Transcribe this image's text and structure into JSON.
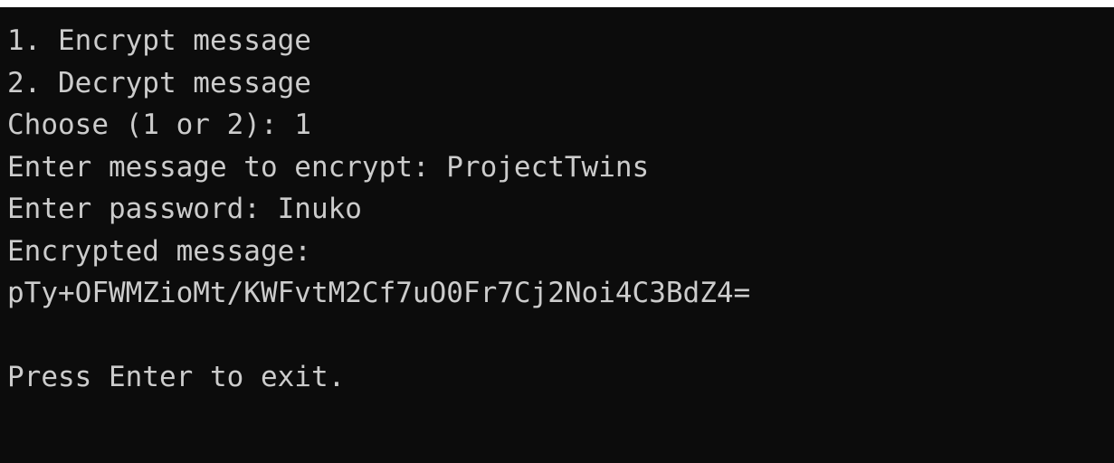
{
  "console": {
    "line1": "1. Encrypt message",
    "line2": "2. Decrypt message",
    "line3": "Choose (1 or 2): 1",
    "line4": "Enter message to encrypt: ProjectTwins",
    "line5": "Enter password: Inuko",
    "line6": "Encrypted message:",
    "line7": "pTy+OFWMZioMt/KWFvtM2Cf7uO0Fr7Cj2Noi4C3BdZ4=",
    "line8": "Press Enter to exit.",
    "colors": {
      "background": "#0c0c0c",
      "text": "#cccccc"
    }
  }
}
